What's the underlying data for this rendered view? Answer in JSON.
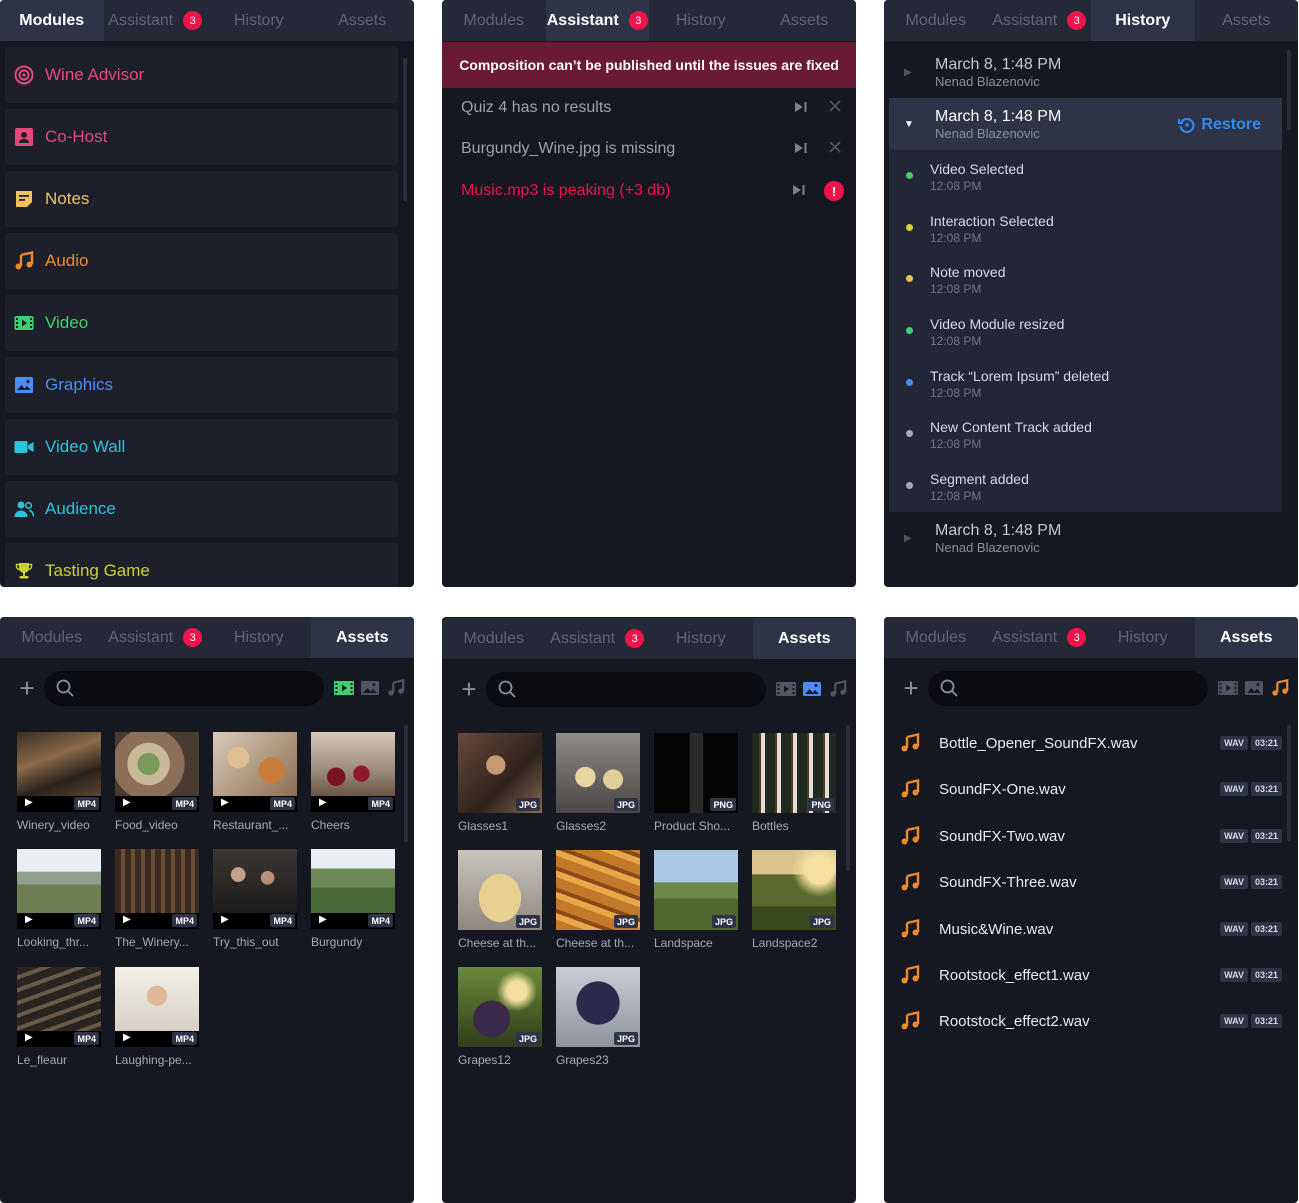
{
  "tabs": {
    "modules": "Modules",
    "assistant": "Assistant",
    "history": "History",
    "assets": "Assets",
    "badge": "3"
  },
  "modules": [
    {
      "label": "Wine Advisor",
      "icon": "radar-icon",
      "color": "#e5487a"
    },
    {
      "label": "Co-Host",
      "icon": "person-card-icon",
      "color": "#e5487a"
    },
    {
      "label": "Notes",
      "icon": "note-icon",
      "color": "#f3c15a"
    },
    {
      "label": "Audio",
      "icon": "music-note-icon",
      "color": "#f08a2b"
    },
    {
      "label": "Video",
      "icon": "film-icon",
      "color": "#3fcf6f"
    },
    {
      "label": "Graphics",
      "icon": "image-icon",
      "color": "#4b8df5"
    },
    {
      "label": "Video Wall",
      "icon": "camera-icon",
      "color": "#2bc4d8"
    },
    {
      "label": "Audience",
      "icon": "people-icon",
      "color": "#2bc4d8"
    },
    {
      "label": "Tasting Game",
      "icon": "trophy-icon",
      "color": "#c9d22b"
    }
  ],
  "assistant": {
    "alert": "Composition can’t be published until the issues are fixed",
    "issues": [
      {
        "text": "Quiz 4 has no results",
        "error": false
      },
      {
        "text": "Burgundy_Wine.jpg is missing",
        "error": false
      },
      {
        "text": "Music.mp3 is peaking (+3 db)",
        "error": true
      }
    ]
  },
  "history": {
    "groups": [
      {
        "date": "March 8, 1:48 PM",
        "user": "Nenad Blazenovic"
      },
      {
        "date": "March 8, 1:48 PM",
        "user": "Nenad Blazenovic",
        "restore": "Restore"
      },
      {
        "date": "March 8, 1:48 PM",
        "user": "Nenad Blazenovic"
      }
    ],
    "events": [
      {
        "title": "Video Selected",
        "time": "12:08 PM",
        "color": "#3fcf6f"
      },
      {
        "title": "Interaction Selected",
        "time": "12:08 PM",
        "color": "#d8d23a"
      },
      {
        "title": "Note moved",
        "time": "12:08 PM",
        "color": "#f3c15a"
      },
      {
        "title": "Video Module resized",
        "time": "12:08 PM",
        "color": "#3fcf6f"
      },
      {
        "title": "Track “Lorem Ipsum” deleted",
        "time": "12:08 PM",
        "color": "#4b8df5"
      },
      {
        "title": "New Content Track added",
        "time": "12:08 PM",
        "color": "#a4a9bf"
      },
      {
        "title": "Segment added",
        "time": "12:08 PM",
        "color": "#a4a9bf"
      }
    ]
  },
  "assets_video": [
    {
      "name": "Winery_video",
      "type": "MP4"
    },
    {
      "name": "Food_video",
      "type": "MP4"
    },
    {
      "name": "Restaurant_...",
      "type": "MP4"
    },
    {
      "name": "Cheers",
      "type": "MP4"
    },
    {
      "name": "Looking_thr...",
      "type": "MP4"
    },
    {
      "name": "The_Winery...",
      "type": "MP4"
    },
    {
      "name": "Try_this_out",
      "type": "MP4"
    },
    {
      "name": "Burgundy",
      "type": "MP4"
    },
    {
      "name": "Le_fleaur",
      "type": "MP4"
    },
    {
      "name": "Laughing-pe...",
      "type": "MP4"
    }
  ],
  "assets_image": [
    {
      "name": "Glasses1",
      "type": "JPG"
    },
    {
      "name": "Glasses2",
      "type": "JPG"
    },
    {
      "name": "Product Sho...",
      "type": "PNG"
    },
    {
      "name": "Bottles",
      "type": "PNG"
    },
    {
      "name": "Cheese at th...",
      "type": "JPG"
    },
    {
      "name": "Cheese at th...",
      "type": "JPG"
    },
    {
      "name": "Landspace",
      "type": "JPG"
    },
    {
      "name": "Landspace2",
      "type": "JPG"
    },
    {
      "name": "Grapes12",
      "type": "JPG"
    },
    {
      "name": "Grapes23",
      "type": "JPG"
    }
  ],
  "assets_audio": [
    {
      "name": "Bottle_Opener_SoundFX.wav",
      "format": "WAV",
      "duration": "03:21"
    },
    {
      "name": "SoundFX-One.wav",
      "format": "WAV",
      "duration": "03:21"
    },
    {
      "name": "SoundFX-Two.wav",
      "format": "WAV",
      "duration": "03:21"
    },
    {
      "name": "SoundFX-Three.wav",
      "format": "WAV",
      "duration": "03:21"
    },
    {
      "name": "Music&Wine.wav",
      "format": "WAV",
      "duration": "03:21"
    },
    {
      "name": "Rootstock_effect1.wav",
      "format": "WAV",
      "duration": "03:21"
    },
    {
      "name": "Rootstock_effect2.wav",
      "format": "WAV",
      "duration": "03:21"
    }
  ]
}
